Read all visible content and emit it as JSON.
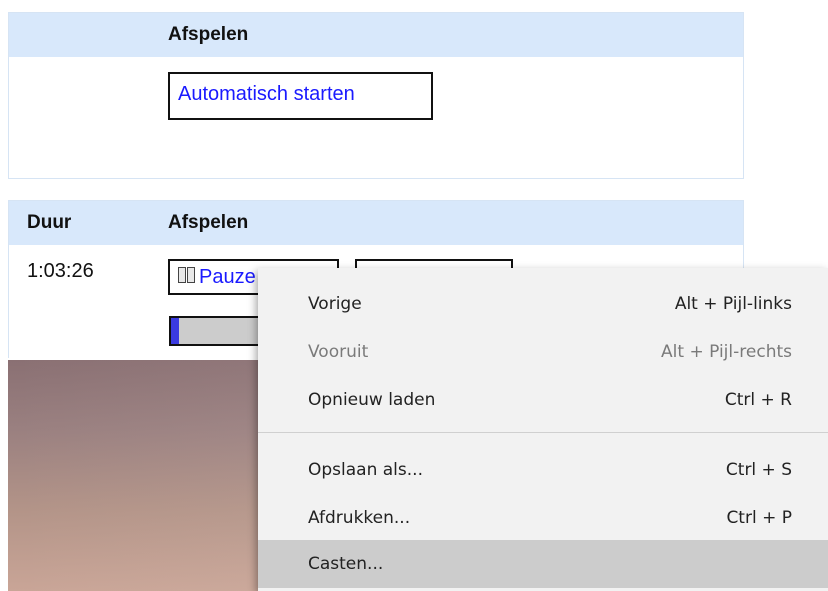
{
  "top_panel": {
    "header": "Afspelen",
    "autostart_button": "Automatisch starten"
  },
  "bottom_panel": {
    "headers": {
      "duration": "Duur",
      "play": "Afspelen"
    },
    "duration_value": "1:03:26",
    "pause_button": "Pauze",
    "progress": 0.05
  },
  "context_menu": {
    "items": [
      {
        "label": "Vorige",
        "shortcut": "Alt + Pijl-links",
        "disabled": false
      },
      {
        "label": "Vooruit",
        "shortcut": "Alt + Pijl-rechts",
        "disabled": true
      },
      {
        "label": "Opnieuw laden",
        "shortcut": "Ctrl + R",
        "disabled": false
      },
      {
        "label": "Opslaan als...",
        "shortcut": "Ctrl + S",
        "disabled": false
      },
      {
        "label": "Afdrukken...",
        "shortcut": "Ctrl + P",
        "disabled": false
      },
      {
        "label": "Casten...",
        "shortcut": "",
        "disabled": false,
        "highlighted": true
      }
    ]
  },
  "colors": {
    "header_bg": "#d8e8fb",
    "link_blue": "#1a1aff",
    "progress_fill": "#3a3ae0",
    "menu_bg": "#f2f2f2",
    "menu_hover": "#cccccc"
  }
}
